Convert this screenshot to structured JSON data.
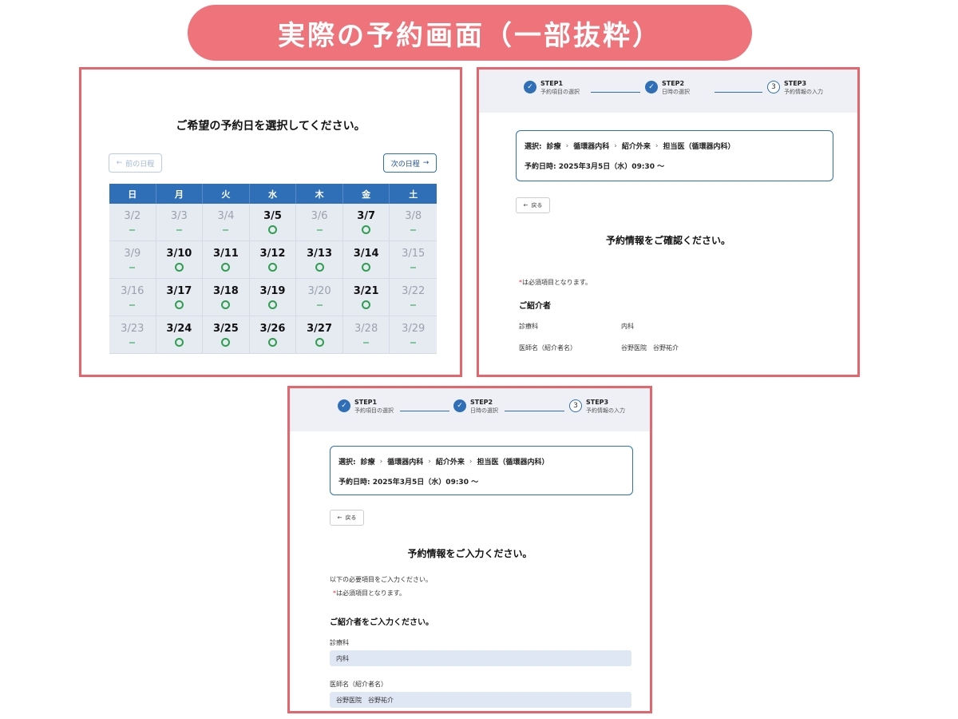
{
  "banner": {
    "title": "実際の予約画面（一部抜粋）"
  },
  "calendar": {
    "title": "ご希望の予約日を選択してください。",
    "prev_label": "前の日程",
    "next_label": "次の日程",
    "weekdays": [
      "日",
      "月",
      "火",
      "水",
      "木",
      "金",
      "土"
    ],
    "cells": [
      {
        "date": "3/2",
        "available": false
      },
      {
        "date": "3/3",
        "available": false
      },
      {
        "date": "3/4",
        "available": false
      },
      {
        "date": "3/5",
        "available": true
      },
      {
        "date": "3/6",
        "available": false
      },
      {
        "date": "3/7",
        "available": true
      },
      {
        "date": "3/8",
        "available": false
      },
      {
        "date": "3/9",
        "available": false
      },
      {
        "date": "3/10",
        "available": true
      },
      {
        "date": "3/11",
        "available": true
      },
      {
        "date": "3/12",
        "available": true
      },
      {
        "date": "3/13",
        "available": true
      },
      {
        "date": "3/14",
        "available": true
      },
      {
        "date": "3/15",
        "available": false
      },
      {
        "date": "3/16",
        "available": false
      },
      {
        "date": "3/17",
        "available": true
      },
      {
        "date": "3/18",
        "available": true
      },
      {
        "date": "3/19",
        "available": true
      },
      {
        "date": "3/20",
        "available": false
      },
      {
        "date": "3/21",
        "available": true
      },
      {
        "date": "3/22",
        "available": false
      },
      {
        "date": "3/23",
        "available": false
      },
      {
        "date": "3/24",
        "available": true
      },
      {
        "date": "3/25",
        "available": true
      },
      {
        "date": "3/26",
        "available": true
      },
      {
        "date": "3/27",
        "available": true
      },
      {
        "date": "3/28",
        "available": false
      },
      {
        "date": "3/29",
        "available": false
      }
    ]
  },
  "stepper": {
    "steps": [
      {
        "label": "STEP1",
        "sub": "予約項目の選択",
        "done": true
      },
      {
        "label": "STEP2",
        "sub": "日時の選択",
        "done": true
      },
      {
        "label": "STEP3",
        "sub": "予約情報の入力",
        "done": false,
        "number": "3"
      }
    ]
  },
  "selection": {
    "prefix": "選択:",
    "path": [
      "診療",
      "循環器内科",
      "紹介外来",
      "担当医（循環器内科）"
    ],
    "datetime": "予約日時: 2025年3月5日（水）09:30 ～"
  },
  "back_label": "戻る",
  "confirm": {
    "heading": "予約情報をご確認ください。",
    "required_note": "は必須項目となります。",
    "section": "ご紹介者",
    "rows": [
      {
        "label": "診療科",
        "value": "内科"
      },
      {
        "label": "医師名（紹介者名）",
        "value": "谷野医院　谷野祐介"
      }
    ]
  },
  "input": {
    "heading": "予約情報をご入力ください。",
    "instruction": "以下の必要項目をご入力ください。",
    "required_note": "は必須項目となります。",
    "section": "ご紹介者をご入力ください。",
    "fields": [
      {
        "label": "診療科",
        "value": "内科"
      },
      {
        "label": "医師名（紹介者名）",
        "value": "谷野医院　谷野祐介"
      }
    ]
  }
}
